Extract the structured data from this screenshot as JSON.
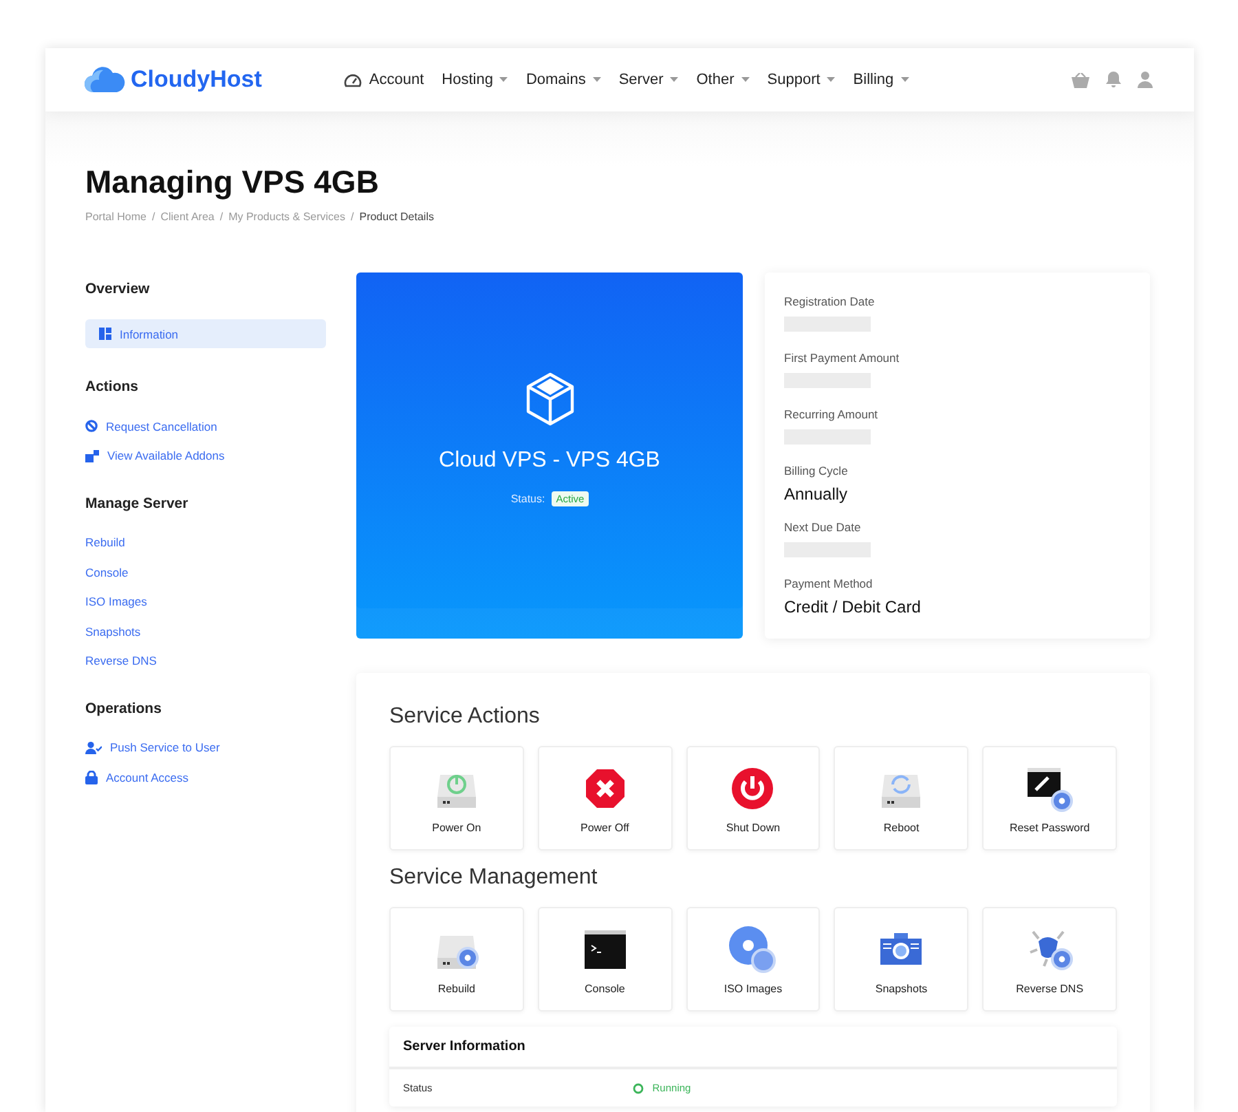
{
  "header": {
    "brand": "CloudyHost",
    "nav": [
      {
        "label": "Account",
        "dropdown": false
      },
      {
        "label": "Hosting",
        "dropdown": true
      },
      {
        "label": "Domains",
        "dropdown": true
      },
      {
        "label": "Server",
        "dropdown": true
      },
      {
        "label": "Other",
        "dropdown": true
      },
      {
        "label": "Support",
        "dropdown": true
      },
      {
        "label": "Billing",
        "dropdown": true
      }
    ]
  },
  "page": {
    "title": "Managing VPS 4GB",
    "breadcrumb_separator": "/",
    "breadcrumbs": [
      {
        "label": "Portal Home",
        "selected": false
      },
      {
        "label": "Client Area",
        "selected": false
      },
      {
        "label": "My Products & Services",
        "selected": false
      },
      {
        "label": "Product Details",
        "selected": true
      }
    ]
  },
  "sidebar": {
    "sections": [
      {
        "title": "Overview",
        "items": [
          {
            "label": "Information",
            "selected": true
          }
        ]
      },
      {
        "title": "Actions",
        "items": [
          {
            "label": "Request Cancellation",
            "selected": false
          },
          {
            "label": "View Available Addons",
            "selected": false
          }
        ]
      },
      {
        "title": "Manage Server",
        "items": [
          {
            "label": "Rebuild",
            "selected": false
          },
          {
            "label": "Console",
            "selected": false
          },
          {
            "label": "ISO Images",
            "selected": false
          },
          {
            "label": "Snapshots",
            "selected": false
          },
          {
            "label": "Reverse DNS",
            "selected": false
          }
        ]
      },
      {
        "title": "Operations",
        "items": [
          {
            "label": "Push Service to User",
            "selected": false
          },
          {
            "label": "Account Access",
            "selected": false
          }
        ]
      }
    ]
  },
  "product": {
    "name": "Cloud VPS - VPS 4GB",
    "status_label": "Status:",
    "status": "Active"
  },
  "details": [
    {
      "label": "Registration Date",
      "kind": "hidden"
    },
    {
      "label": "First Payment Amount",
      "kind": "hidden"
    },
    {
      "label": "Recurring Amount",
      "kind": "hidden"
    },
    {
      "label": "Billing Cycle",
      "kind": "text",
      "value": "Annually"
    },
    {
      "label": "Next Due Date",
      "kind": "hidden"
    },
    {
      "label": "Payment Method",
      "kind": "text",
      "value": "Credit / Debit Card"
    }
  ],
  "service_actions": {
    "title": "Service Actions",
    "tiles": [
      "Power On",
      "Power Off",
      "Shut Down",
      "Reboot",
      "Reset Password"
    ]
  },
  "service_management": {
    "title": "Service Management",
    "tiles": [
      "Rebuild",
      "Console",
      "ISO Images",
      "Snapshots",
      "Reverse DNS"
    ]
  },
  "server_information": {
    "title": "Server Information",
    "rows": [
      {
        "label": "Status",
        "value": "Running"
      }
    ]
  }
}
